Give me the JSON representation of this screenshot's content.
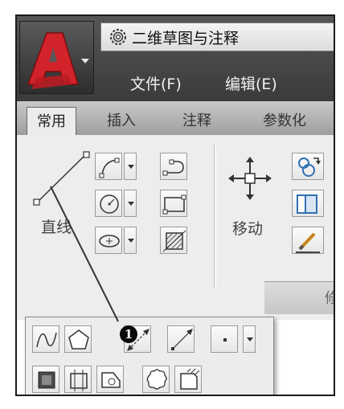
{
  "title_bar": {
    "workspace_title": "二维草图与注释"
  },
  "menu": {
    "file": "文件(F)",
    "edit": "编辑(E)"
  },
  "tabs": [
    {
      "label": "常用",
      "active": true
    },
    {
      "label": "插入",
      "active": false
    },
    {
      "label": "注释",
      "active": false
    },
    {
      "label": "参数化",
      "active": false
    }
  ],
  "draw_panel": {
    "line_label": "直线"
  },
  "modify_panel": {
    "move_label": "移动",
    "panel_title_partial": "修"
  },
  "callout": {
    "number": "1"
  },
  "icons": [
    "autocad-logo-icon",
    "gear-icon",
    "line-icon",
    "arc-icon",
    "circle-icon",
    "ellipse-icon",
    "polyline-icon",
    "rectangle-icon",
    "hatch-icon",
    "move-icon",
    "copy-icon",
    "stretch-icon",
    "brush-icon",
    "spline-icon",
    "polygon-icon",
    "xline-icon",
    "ray-icon",
    "point-icon",
    "boundary-icon",
    "region-icon",
    "wipeout-icon",
    "revcloud-icon",
    "cloud-icon"
  ],
  "colors": {
    "logo_red": "#d2232a",
    "accent_blue": "#2f6fb5",
    "titlebar": "#4a4a4a"
  }
}
